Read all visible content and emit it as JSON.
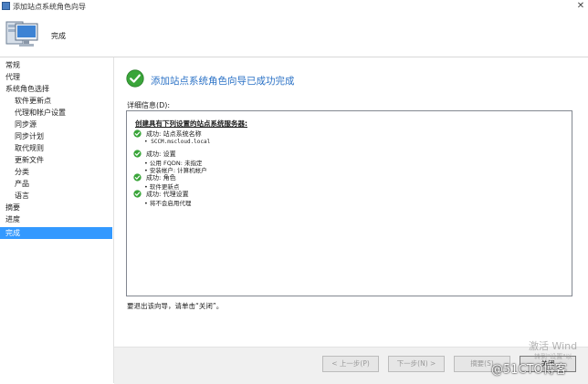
{
  "window": {
    "title": "添加站点系统角色向导",
    "close_symbol": "✕"
  },
  "header": {
    "title": "完成",
    "icon": "computer-icon"
  },
  "sidebar": {
    "items": [
      {
        "label": "常规",
        "level": 1,
        "active": false
      },
      {
        "label": "代理",
        "level": 1,
        "active": false
      },
      {
        "label": "系统角色选择",
        "level": 1,
        "active": false
      },
      {
        "label": "软件更新点",
        "level": 2,
        "active": false
      },
      {
        "label": "代理和帐户设置",
        "level": 2,
        "active": false
      },
      {
        "label": "同步源",
        "level": 2,
        "active": false
      },
      {
        "label": "同步计划",
        "level": 2,
        "active": false
      },
      {
        "label": "取代规则",
        "level": 2,
        "active": false
      },
      {
        "label": "更新文件",
        "level": 2,
        "active": false
      },
      {
        "label": "分类",
        "level": 2,
        "active": false
      },
      {
        "label": "产品",
        "level": 2,
        "active": false
      },
      {
        "label": "语言",
        "level": 2,
        "active": false
      },
      {
        "label": "摘要",
        "level": 1,
        "active": false
      },
      {
        "label": "进度",
        "level": 1,
        "active": false
      },
      {
        "label": "完成",
        "level": 1,
        "active": true
      }
    ]
  },
  "main": {
    "success_heading": "添加站点系统角色向导已成功完成",
    "details_label": "详细信息(D):",
    "details": {
      "header": "创建具有下列设置的站点系统服务器:",
      "blocks": [
        {
          "title": "成功: 站点系统名称",
          "lines": [
            "• SCCM.mscloud.local"
          ]
        },
        {
          "title": "成功: 设置",
          "lines": [
            "• 公用 FQDN: 未指定",
            "• 安装帐户: 计算机帐户"
          ]
        },
        {
          "title": "成功: 角色",
          "lines": [
            "• 软件更新点"
          ]
        },
        {
          "title": "成功: 代理设置",
          "lines": [
            "• 将不会启用代理"
          ]
        }
      ]
    },
    "exit_hint": "要退出该向导，请单击“关闭”。"
  },
  "footer": {
    "prev_label": "< 上一步(P)",
    "next_label": "下一步(N) >",
    "summary_label": "摘要(S)",
    "close_label": "关闭"
  },
  "watermark": {
    "activate": "激活 Wind",
    "settings": "转到\"设置\"以",
    "blog": "@51CTO博客"
  },
  "colors": {
    "accent": "#3399ff",
    "heading": "#2b72c6",
    "success": "#3aa53a"
  }
}
